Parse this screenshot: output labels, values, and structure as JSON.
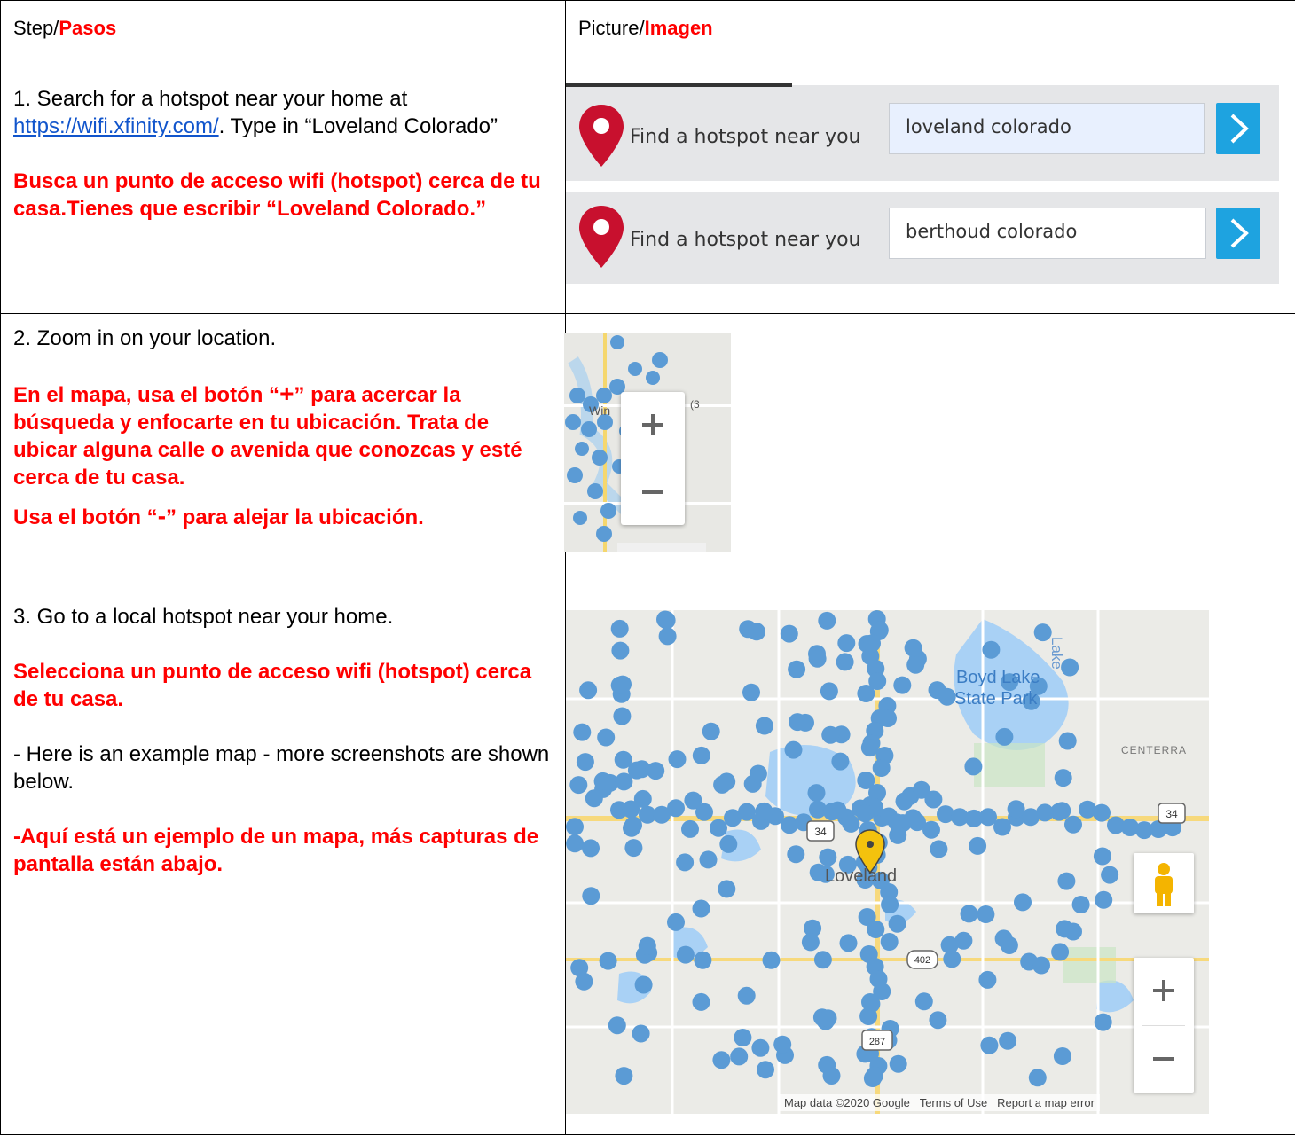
{
  "header": {
    "step_en": "Step/",
    "step_es": "Pasos",
    "picture_en": "Picture/",
    "picture_es": "Imagen"
  },
  "row1": {
    "en_prefix": "1. Search for a hotspot near your home at ",
    "link": "https://wifi.xfinity.com/",
    "en_suffix": ". Type in “Loveland Colorado”",
    "es": "Busca un punto de acceso wifi (hotspot) cerca de tu casa.Tienes que escribir “Loveland Colorado.”",
    "search_bars": [
      {
        "label": "Find a hotspot near you",
        "value": "loveland colorado"
      },
      {
        "label": "Find a hotspot near you",
        "value": "berthoud colorado"
      }
    ]
  },
  "row2": {
    "en": "2. Zoom in on your location.",
    "es_a_pre": "En el mapa, usa el botón “",
    "es_a_sym": "+",
    "es_a_post": "” para acercar la búsqueda y enfocarte en tu ubicación. Trata de ubicar alguna calle o avenida que conozcas y esté cerca de tu casa.",
    "es_b_pre": "Usa el botón “",
    "es_b_sym": "-",
    "es_b_post": "” para alejar la ubicación.",
    "map_labels": {
      "win": "Win",
      "road": "(3"
    }
  },
  "row3": {
    "en": "3. Go to a local hotspot near your home.",
    "es": "Selecciona un punto de acceso wifi (hotspot) cerca de tu casa.",
    "en2": "- Here is an example map - more screenshots are shown below.",
    "es2": "-Aquí está un ejemplo de un mapa, más capturas de pantalla están abajo.",
    "map": {
      "lake_label": "Lake",
      "park_label_1": "Boyd Lake",
      "park_label_2": "State Park",
      "centerra": "CENTERRA",
      "city": "Loveland",
      "route_34_a": "34",
      "route_34_b": "34",
      "route_402": "402",
      "route_287": "287",
      "footer_data": "Map data ©2020 Google",
      "footer_terms": "Terms of Use",
      "footer_report": "Report a map error",
      "hotspot_color": "#5b9bd5",
      "pin_color": "#f4c20d"
    }
  }
}
